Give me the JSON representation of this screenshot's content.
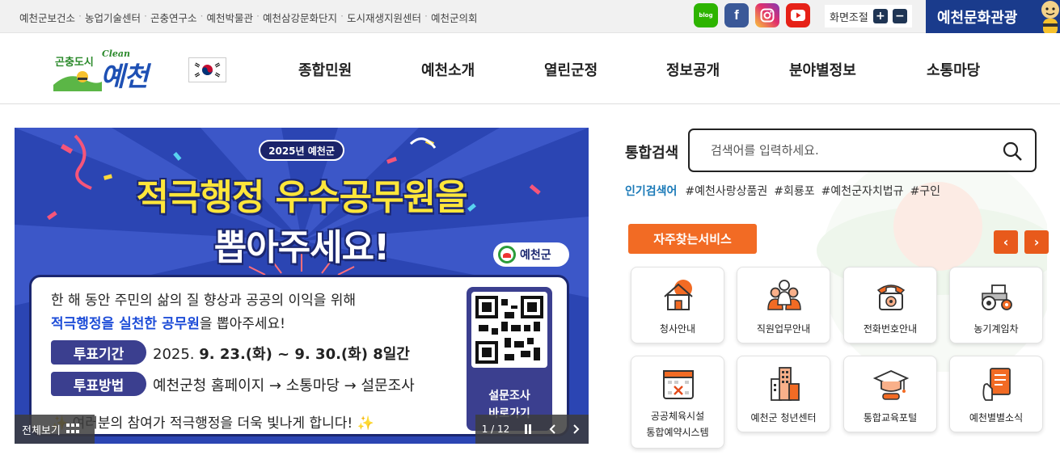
{
  "topbar": {
    "links": [
      "예천군보건소",
      "농업기술센터",
      "곤충연구소",
      "예천박물관",
      "예천삼강문화단지",
      "도시재생지원센터",
      "예천군의회"
    ],
    "sns": {
      "blog": "blog",
      "facebook": "f"
    },
    "zoom_label": "화면조절",
    "zoom_in": "+",
    "zoom_out": "−",
    "culture_label": "예천문화관광"
  },
  "header": {
    "logo_tag": "곤충도시",
    "logo_clean": "Clean",
    "logo_main": "예천",
    "nav": [
      "종합민원",
      "예천소개",
      "열린군정",
      "정보공개",
      "분야별정보",
      "소통마당"
    ]
  },
  "banner": {
    "pill": "2025년 예천군",
    "headline1": "적극행정 우수공무원을",
    "headline2": "뽑아주세요!",
    "badge": "예천군",
    "line1": "한 해 동안 주민의 삶의 질 향상과 공공의 이익을 위해",
    "line2_highlight": "적극행정을 실천한 공무원",
    "line2_rest": "을 뽑아주세요!",
    "vote_period_label": "투표기간",
    "vote_period_prefix": "2025.",
    "vote_period_value": "9. 23.(화) ~ 9. 30.(화) 8일간",
    "vote_method_label": "투표방법",
    "vote_method_value": "예천군청 홈페이지 → 소통마당 → 설문조사",
    "closing": "✨ 여러분의 참여가 적극행정을 더욱 빛나게 합니다! ✨",
    "qr_line1": "설문조사",
    "qr_line2": "바로가기",
    "view_all": "전체보기",
    "pager": "1 / 12"
  },
  "search": {
    "label": "통합검색",
    "placeholder": "검색어를 입력하세요.",
    "popular_label": "인기검색어",
    "keywords": [
      "#예천사랑상품권",
      "#회룡포",
      "#예천군자치법규",
      "#구인"
    ]
  },
  "services": {
    "title": "자주찾는서비스",
    "prev": "‹",
    "next": "›",
    "items": [
      {
        "label": "청사안내",
        "icon": "building-icon"
      },
      {
        "label": "직원업무안내",
        "icon": "staff-icon"
      },
      {
        "label": "전화번호안내",
        "icon": "telephone-icon"
      },
      {
        "label": "농기계임차",
        "icon": "tractor-icon"
      },
      {
        "label": "공공체육시설\n통합예약시스템",
        "icon": "calendar-icon"
      },
      {
        "label": "예천군 청년센터",
        "icon": "tower-icon"
      },
      {
        "label": "통합교육포털",
        "icon": "graduation-cap-icon"
      },
      {
        "label": "예천별별소식",
        "icon": "news-icon"
      }
    ]
  },
  "colors": {
    "accent_orange": "#f26b24",
    "banner_blue": "#2b45b3",
    "navy": "#1b2770",
    "culture_blue": "#1a3b8c"
  }
}
